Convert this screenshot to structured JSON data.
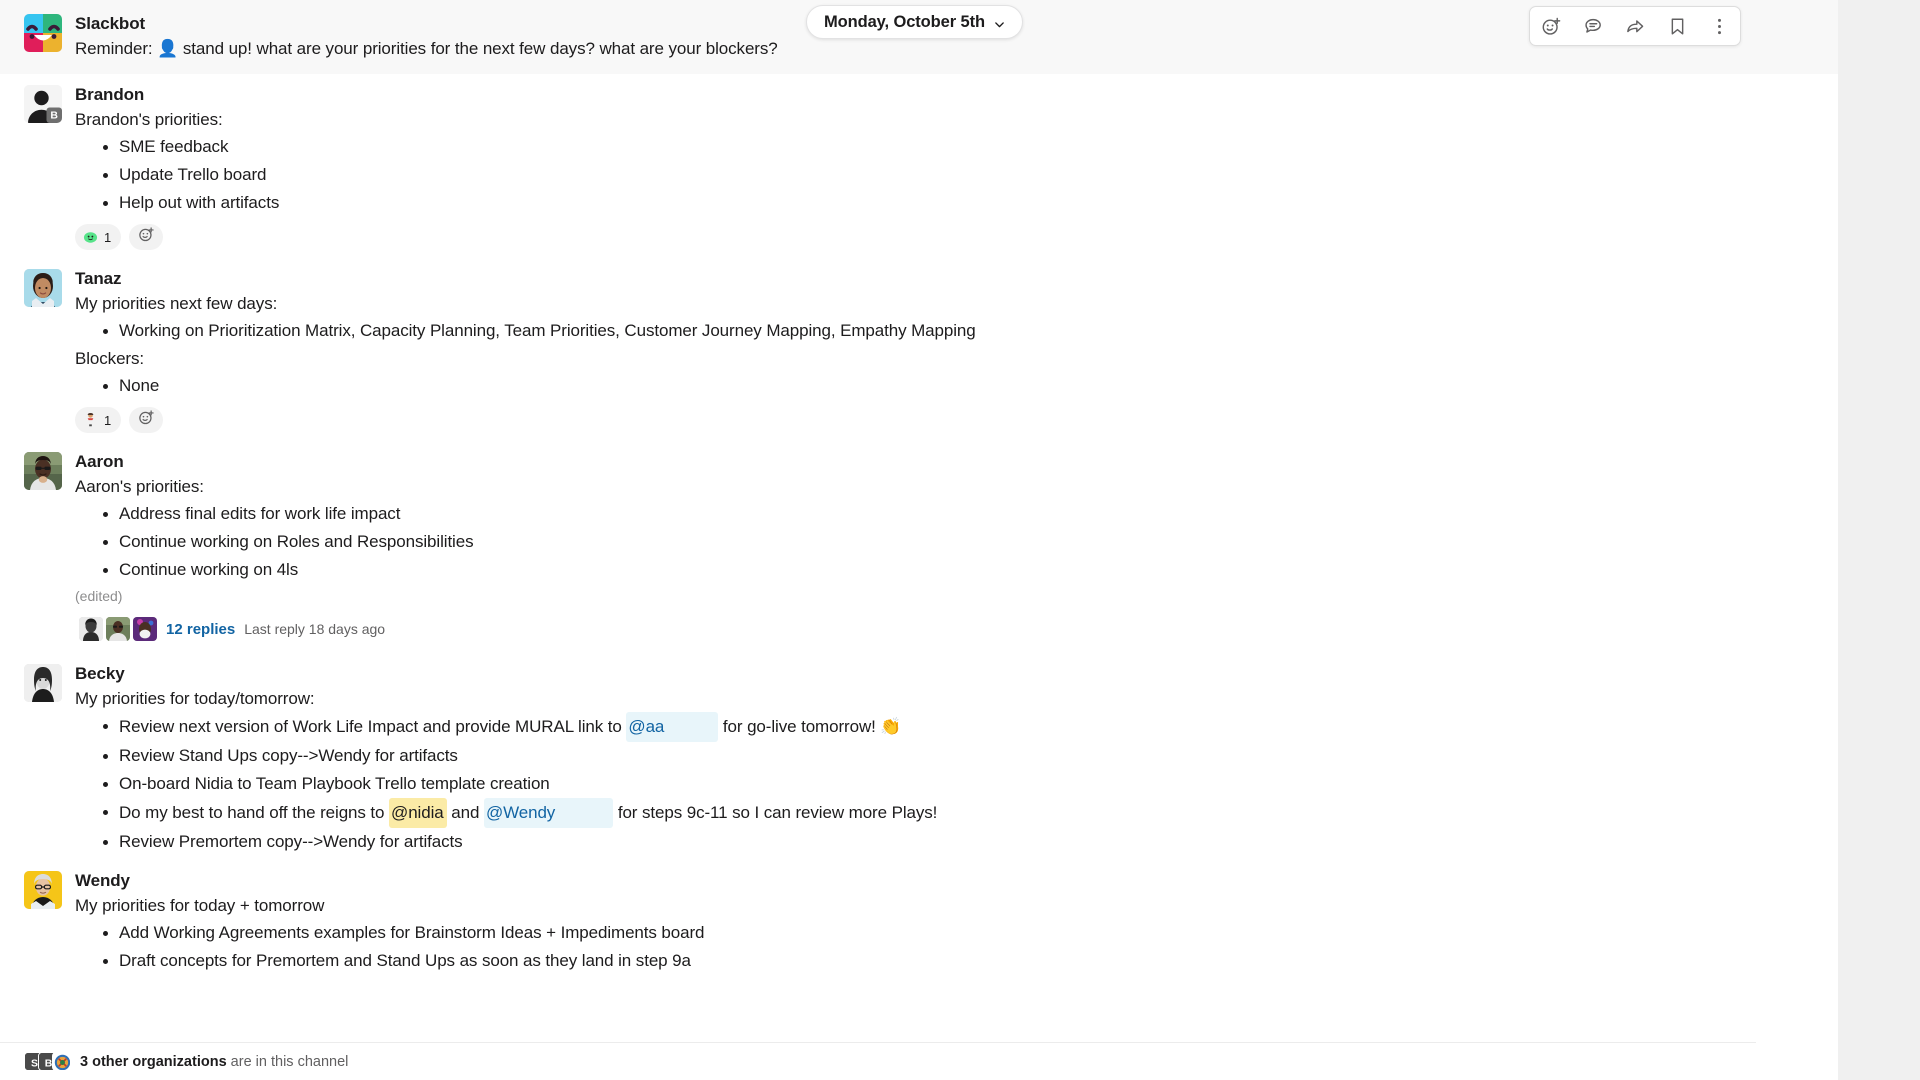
{
  "header": {
    "date_label": "Monday, October 5th",
    "chevron_icon": "chevron-down-icon",
    "actions": [
      {
        "name": "add-reaction-icon",
        "label": "Add reaction"
      },
      {
        "name": "reply-in-thread-icon",
        "label": "Reply in thread"
      },
      {
        "name": "share-message-icon",
        "label": "Share message"
      },
      {
        "name": "save-message-icon",
        "label": "Save for later"
      },
      {
        "name": "more-actions-icon",
        "label": "More actions"
      }
    ]
  },
  "colors": {
    "link": "#1264a3",
    "mention_blue_bg": "#e8f5fa",
    "mention_self_bg": "#fbeba6",
    "text": "#1d1c1d",
    "muted": "#616061",
    "pane": "#ffffff",
    "gutter": "#f0f0f0",
    "slackbot_row_bg": "#f8f8f8"
  },
  "messages": [
    {
      "id": "slackbot",
      "author": "Slackbot",
      "avatar_kind": "slackbot-logo",
      "intro": "Reminder:",
      "reminder_emoji": "👤",
      "reminder_text": "stand up! what are your priorities for the next few days? what are your blockers?",
      "bullets": [],
      "reactions": []
    },
    {
      "id": "brandon",
      "author": "Brandon",
      "avatar_kind": "default-silhouette",
      "avatar_badge": "B",
      "intro": "Brandon's priorities:",
      "bullets": [
        "SME feedback",
        "Update Trello board",
        "Help out with artifacts"
      ],
      "reactions": [
        {
          "emoji": "🟢",
          "count": "1",
          "name": "green-blob-reaction"
        }
      ]
    },
    {
      "id": "tanaz",
      "author": "Tanaz",
      "avatar_kind": "tanaz-portrait",
      "intro": "My priorities next few days:",
      "bullets": [
        "Working on Prioritization Matrix, Capacity Planning, Team Priorities, Customer Journey Mapping, Empathy Mapping"
      ],
      "second_intro": "Blockers:",
      "second_bullets": [
        "None"
      ],
      "reactions": [
        {
          "emoji": "🧑‍🔬",
          "count": "1",
          "name": "person-reaction"
        }
      ]
    },
    {
      "id": "aaron",
      "author": "Aaron",
      "avatar_kind": "aaron-portrait",
      "intro": "Aaron's priorities:",
      "bullets": [
        "Address final edits for work life impact",
        "Continue working on Roles and Responsibilities",
        "Continue working on 4ls"
      ],
      "edited_label": "(edited)",
      "thread": {
        "replies_label": "12 replies",
        "last_reply_label": "Last reply 18 days ago",
        "face_count": 3
      },
      "reactions": []
    },
    {
      "id": "becky",
      "author": "Becky",
      "avatar_kind": "becky-portrait",
      "intro": "My priorities for today/tomorrow:",
      "bullets_rich": [
        {
          "parts": [
            {
              "t": "text",
              "v": "Review next version of Work Life Impact and provide MURAL link to "
            },
            {
              "t": "mention",
              "v": "@aa",
              "style": "blue-padded"
            },
            {
              "t": "text",
              "v": " for go-live tomorrow! "
            },
            {
              "t": "emoji",
              "v": "👏"
            }
          ]
        },
        {
          "parts": [
            {
              "t": "text",
              "v": "Review Stand Ups copy-->Wendy for artifacts"
            }
          ]
        },
        {
          "parts": [
            {
              "t": "text",
              "v": "On-board Nidia to Team Playbook Trello template creation"
            }
          ]
        },
        {
          "parts": [
            {
              "t": "text",
              "v": "Do my best to hand off the reigns to "
            },
            {
              "t": "mention",
              "v": "@nidia",
              "style": "self"
            },
            {
              "t": "text",
              "v": " and "
            },
            {
              "t": "mention",
              "v": "@Wendy",
              "style": "blue-padded2"
            },
            {
              "t": "text",
              "v": " for steps 9c-11 so I can review more Plays!"
            }
          ]
        },
        {
          "parts": [
            {
              "t": "text",
              "v": "Review Premortem copy-->Wendy for artifacts"
            }
          ]
        }
      ],
      "reactions": []
    },
    {
      "id": "wendy",
      "author": "Wendy",
      "avatar_kind": "wendy-portrait",
      "intro": "My priorities for today + tomorrow",
      "bullets": [
        "Add Working Agreements examples for Brainstorm Ideas + Impediments board",
        "Draft concepts for Premortem and Stand Ups as soon as they land in step 9a"
      ],
      "reactions": []
    }
  ],
  "footer": {
    "org_count_label": "3 other organizations",
    "org_suffix_label": "are in this channel",
    "org_badges": [
      "S",
      "B",
      ""
    ]
  }
}
